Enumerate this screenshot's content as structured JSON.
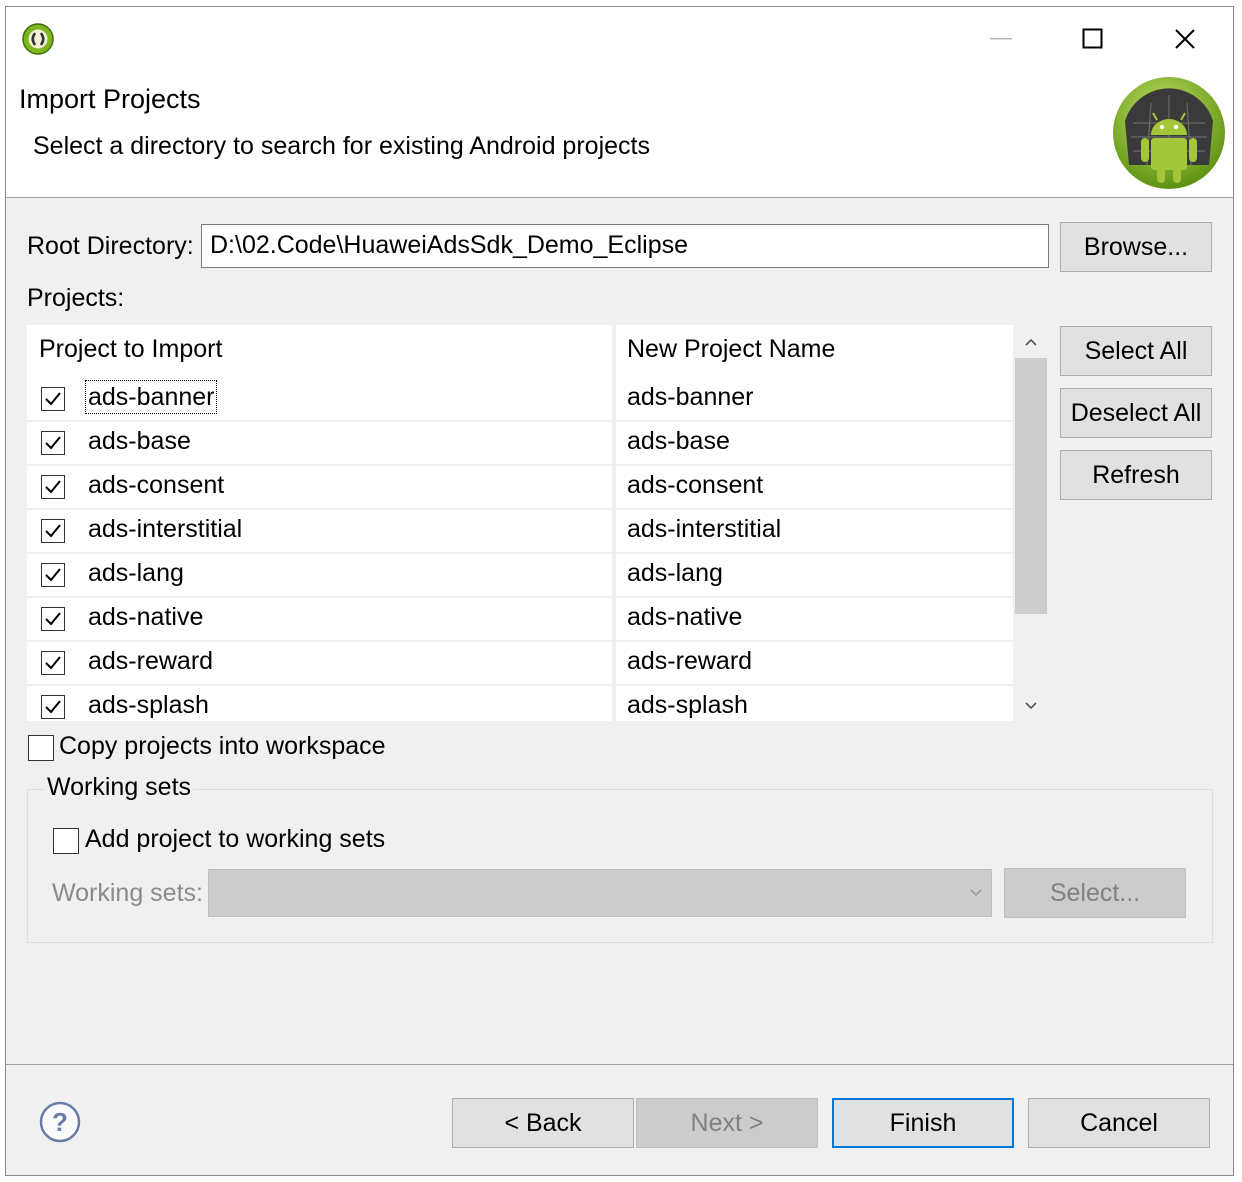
{
  "window": {
    "minimize_icon": "minimize-icon",
    "maximize_icon": "maximize-icon",
    "close_icon": "close-icon"
  },
  "header": {
    "title": "Import Projects",
    "subtitle": "Select a directory to search for existing Android projects",
    "logo_icon": "android-icon"
  },
  "root": {
    "label": "Root Directory:",
    "value": "D:\\02.Code\\HuaweiAdsSdk_Demo_Eclipse",
    "browse_label": "Browse..."
  },
  "projects": {
    "label": "Projects:",
    "col1": "Project to Import",
    "col2": "New Project Name",
    "rows": [
      {
        "name": "ads-banner",
        "new_name": "ads-banner",
        "checked": true
      },
      {
        "name": "ads-base",
        "new_name": "ads-base",
        "checked": true
      },
      {
        "name": "ads-consent",
        "new_name": "ads-consent",
        "checked": true
      },
      {
        "name": "ads-interstitial",
        "new_name": "ads-interstitial",
        "checked": true
      },
      {
        "name": "ads-lang",
        "new_name": "ads-lang",
        "checked": true
      },
      {
        "name": "ads-native",
        "new_name": "ads-native",
        "checked": true
      },
      {
        "name": "ads-reward",
        "new_name": "ads-reward",
        "checked": true
      },
      {
        "name": "ads-splash",
        "new_name": "ads-splash",
        "checked": true
      }
    ]
  },
  "side_buttons": {
    "select_all": "Select All",
    "deselect_all": "Deselect All",
    "refresh": "Refresh"
  },
  "copy": {
    "label": "Copy projects into workspace",
    "checked": false
  },
  "working_sets": {
    "title": "Working sets",
    "add_label": "Add project to working sets",
    "add_checked": false,
    "sets_label": "Working sets:",
    "select_label": "Select..."
  },
  "footer": {
    "help_icon": "help-icon",
    "back": "< Back",
    "next": "Next >",
    "finish": "Finish",
    "cancel": "Cancel"
  },
  "colors": {
    "accent": "#0078d7",
    "dialog_bg": "#f0f0f0",
    "android_green": "#a4c639"
  }
}
